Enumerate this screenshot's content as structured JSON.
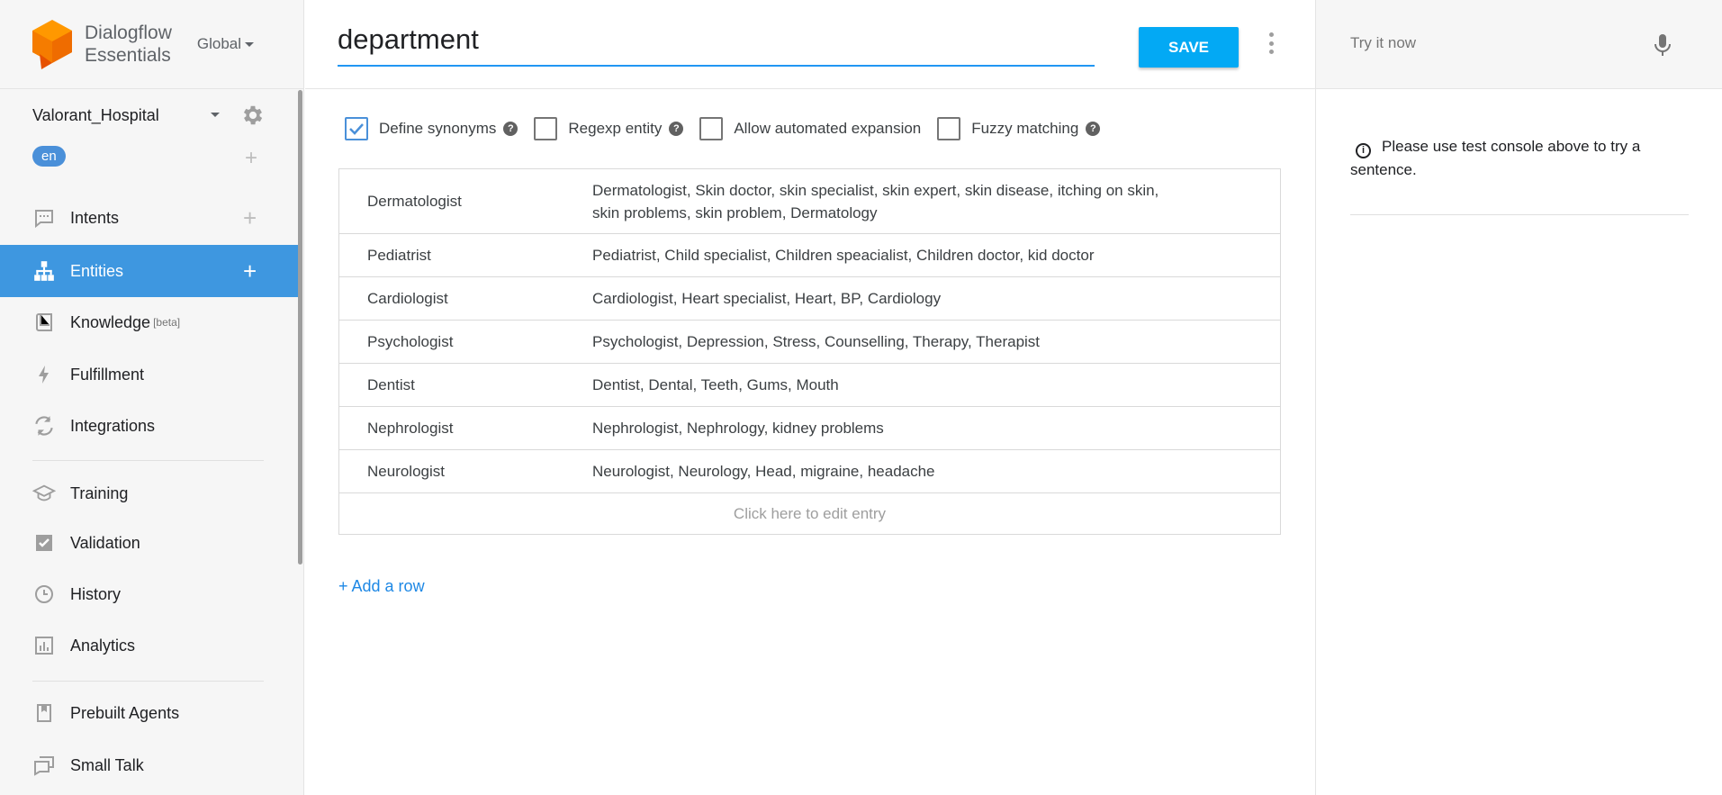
{
  "brand": {
    "name_line1": "Dialogflow",
    "name_line2": "Essentials",
    "region": "Global"
  },
  "agent": {
    "name": "Valorant_Hospital",
    "language": "en"
  },
  "nav": {
    "intents": "Intents",
    "entities": "Entities",
    "knowledge": "Knowledge",
    "knowledge_badge": "[beta]",
    "fulfillment": "Fulfillment",
    "integrations": "Integrations",
    "training": "Training",
    "validation": "Validation",
    "history": "History",
    "analytics": "Analytics",
    "prebuilt": "Prebuilt Agents",
    "smalltalk": "Small Talk"
  },
  "header": {
    "entity_name": "department",
    "save_label": "SAVE"
  },
  "options": {
    "define_synonyms": {
      "label": "Define synonyms",
      "checked": true
    },
    "regexp": {
      "label": "Regexp entity",
      "checked": false
    },
    "auto_expansion": {
      "label": "Allow automated expansion",
      "checked": false
    },
    "fuzzy": {
      "label": "Fuzzy matching",
      "checked": false
    }
  },
  "entries": [
    {
      "value": "Dermatologist",
      "synonyms": "Dermatologist, Skin doctor, skin specialist, skin expert, skin disease, itching on skin, skin problems, skin problem, Dermatology"
    },
    {
      "value": "Pediatrist",
      "synonyms": "Pediatrist, Child specialist, Children speacialist, Children doctor, kid doctor"
    },
    {
      "value": "Cardiologist",
      "synonyms": "Cardiologist, Heart specialist, Heart, BP, Cardiology"
    },
    {
      "value": "Psychologist",
      "synonyms": "Psychologist, Depression, Stress, Counselling, Therapy, Therapist"
    },
    {
      "value": "Dentist",
      "synonyms": "Dentist, Dental, Teeth, Gums, Mouth"
    },
    {
      "value": "Nephrologist",
      "synonyms": "Nephrologist, Nephrology, kidney problems"
    },
    {
      "value": "Neurologist",
      "synonyms": "Neurologist, Neurology, Head, migraine, headache"
    }
  ],
  "table": {
    "edit_entry": "Click here to edit entry",
    "add_row": "+ Add a row"
  },
  "console": {
    "placeholder": "Try it now",
    "info": "Please use test console above to try a sentence."
  },
  "colors": {
    "accent": "#3e97e0",
    "save": "#03a9f4",
    "brand_orange": "#f57c00"
  }
}
